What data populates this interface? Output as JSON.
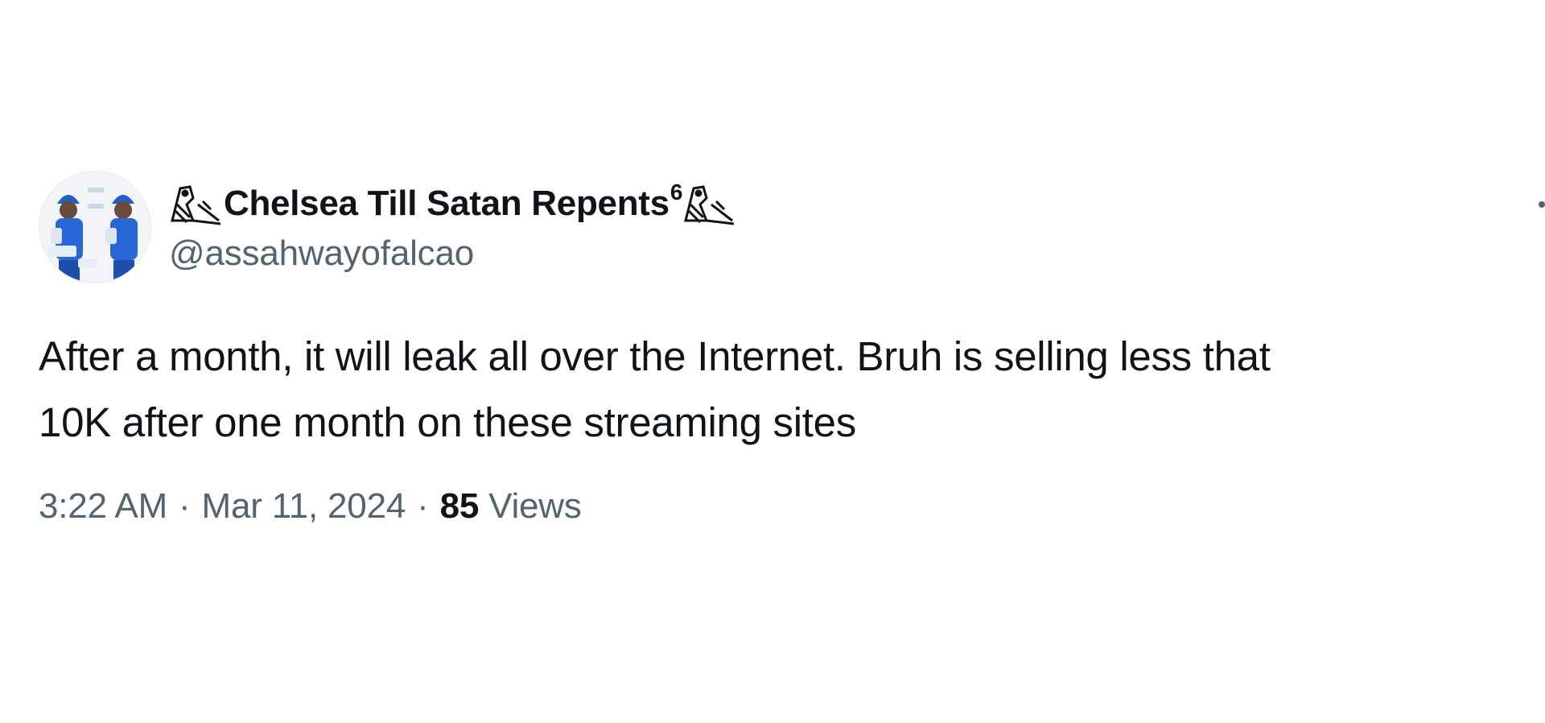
{
  "tweet": {
    "author": {
      "display_name": "Chelsea Till Satan Repents",
      "display_name_superscript": "6",
      "leading_icon": "owl-icon",
      "trailing_icon": "owl-icon",
      "handle": "@assahwayofalcao",
      "avatar_icon": "avatar-image"
    },
    "text_lines": [
      "After a month, it will leak all over the Internet. Bruh is selling less that",
      "10K after one month on these streaming sites"
    ],
    "meta": {
      "time": "3:22 AM",
      "separator": "·",
      "date": "Mar 11, 2024",
      "views_count": "85",
      "views_label": "Views"
    },
    "more_icon": "more-options-icon"
  },
  "colors": {
    "text_primary": "#0f1419",
    "text_secondary": "#536471",
    "background": "#ffffff"
  }
}
